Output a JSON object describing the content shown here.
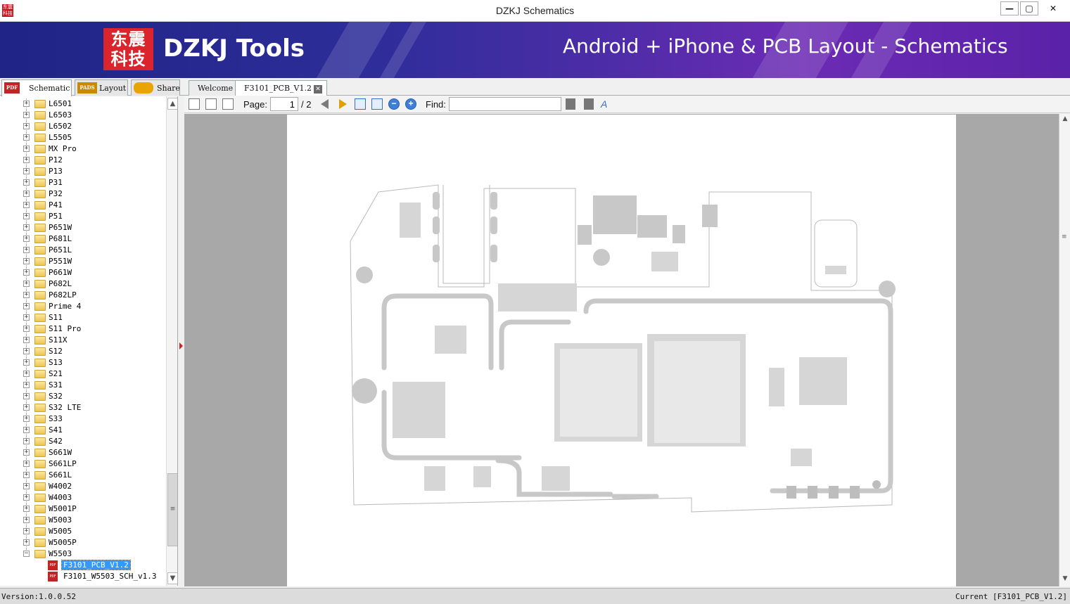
{
  "window": {
    "title": "DZKJ Schematics",
    "icon_text": "东震\n科技",
    "minimize": "—",
    "maximize": "▢",
    "close": "✕"
  },
  "banner": {
    "logo_text_top": "东震",
    "logo_text_bottom": "科技",
    "brand": "DZKJ Tools",
    "tagline": "Android + iPhone & PCB Layout - Schematics",
    "colors": {
      "background": "#2e2d9a",
      "accent": "#6c2bb5",
      "logo": "#d9252b"
    }
  },
  "tabs": {
    "schematic": {
      "label": "Schematic",
      "icon": "PDF"
    },
    "layout": {
      "label": "Layout",
      "icon": "PADS"
    },
    "share": {
      "label": "Share",
      "icon": "cloud-plus-icon"
    },
    "docs": [
      {
        "label": "Welcome"
      },
      {
        "label": "F3101_PCB_V1.2",
        "close": "✕"
      }
    ]
  },
  "tree": {
    "folders": [
      "L6501",
      "L6503",
      "L6502",
      "L5505",
      "MX Pro",
      "P12",
      "P13",
      "P31",
      "P32",
      "P41",
      "P51",
      "P651W",
      "P681L",
      "P651L",
      "P551W",
      "P661W",
      "P682L",
      "P682LP",
      "Prime 4",
      "S11",
      "S11 Pro",
      "S11X",
      "S12",
      "S13",
      "S21",
      "S31",
      "S32",
      "S32 LTE",
      "S33",
      "S41",
      "S42",
      "S661W",
      "S661LP",
      "S661L",
      "W4002",
      "W4003",
      "W5001P",
      "W5003",
      "W5005",
      "W5005P"
    ],
    "expanded_folder": "W5503",
    "files": [
      {
        "label": "F3101_PCB_V1.2",
        "selected": true
      },
      {
        "label": "F3101_W5503_SCH_v1.3",
        "selected": false
      }
    ],
    "expander_collapsed": "+",
    "expander_expanded": "−"
  },
  "toolbar": {
    "page_label": "Page:",
    "page_current": "1",
    "page_total": "/ 2",
    "find_label": "Find:",
    "find_value": ""
  },
  "status": {
    "version": "Version:1.0.0.52",
    "current": "Current [F3101_PCB_V1.2]"
  }
}
